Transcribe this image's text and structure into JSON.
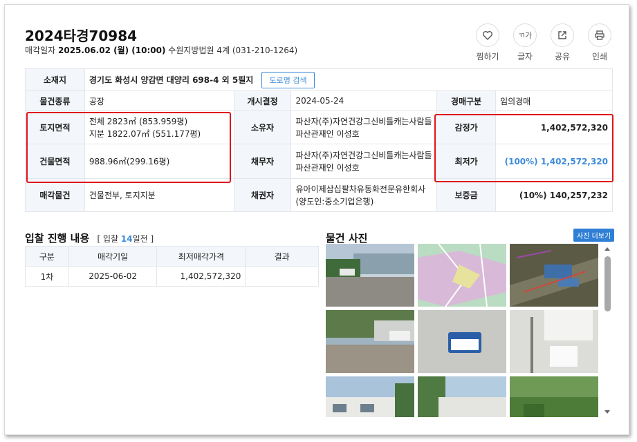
{
  "header": {
    "case_no": "2024타경70984",
    "date_label": "매각일자",
    "date_value": "2025.06.02 (월) (10:00)",
    "court": "수원지방법원 4계 (031-210-1264)"
  },
  "actions": [
    {
      "label": "찜하기",
      "icon": "heart-icon"
    },
    {
      "label": "글자",
      "icon": "text-size-icon",
      "glyph": "ㄲ가"
    },
    {
      "label": "공유",
      "icon": "share-icon"
    },
    {
      "label": "인쇄",
      "icon": "print-icon"
    }
  ],
  "info": {
    "location_label": "소재지",
    "location_value": "경기도 화성시 양감면 대양리 698-4 외 5필지",
    "road_btn": "도로명 검색",
    "type_label": "물건종류",
    "type_value": "공장",
    "start_label": "개시결정",
    "start_value": "2024-05-24",
    "auction_type_label": "경매구분",
    "auction_type_value": "임의경매",
    "land_label": "토지면적",
    "land_line1": "전체 2823㎡ (853.959평)",
    "land_line2": "지분 1822.07㎡ (551.177평)",
    "owner_label": "소유자",
    "owner_value": "파산자(주)자연건강그신비틀캐는사람들 파산관재인 이성호",
    "appraisal_label": "감정가",
    "appraisal_value": "1,402,572,320",
    "building_label": "건물면적",
    "building_value": "988.96㎡(299.16평)",
    "debtor_label": "채무자",
    "debtor_value": "파산자(주)자연건강그신비틀캐는사람들 파산관재인 이성호",
    "min_label": "최저가",
    "min_value": "(100%) 1,402,572,320",
    "sale_items_label": "매각물건",
    "sale_items_value": "건물전부, 토지지분",
    "creditor_label": "채권자",
    "creditor_value": "유아이제삼십팔차유동화전문유한회사(양도인:중소기업은행)",
    "deposit_label": "보증금",
    "deposit_value": "(10%) 140,257,232"
  },
  "bid": {
    "title": "입찰 진행 내용",
    "note_prefix": "[ 입찰",
    "note_days": "14",
    "note_suffix": "일전 ]",
    "columns": [
      "구분",
      "매각기일",
      "최저매각가격",
      "결과"
    ],
    "rows": [
      {
        "round": "1차",
        "date": "2025-06-02",
        "price": "1,402,572,320",
        "result": ""
      }
    ]
  },
  "photos": {
    "title": "물건 사진",
    "more_btn": "사진 더보기"
  },
  "colors": {
    "accent": "#3d8bd9",
    "highlight_box": "#e0121b",
    "header_bg": "#f3f7fb"
  }
}
